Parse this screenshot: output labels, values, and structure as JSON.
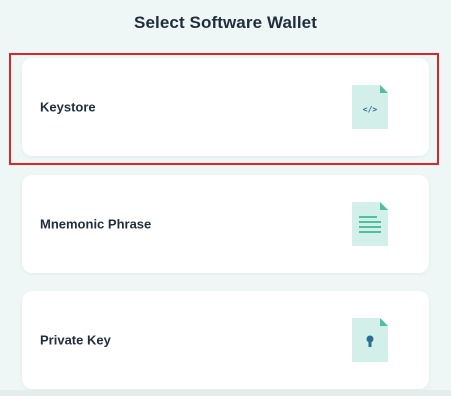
{
  "header": {
    "title": "Select Software Wallet"
  },
  "options": [
    {
      "label": "Keystore",
      "icon": "code-file-icon",
      "selected": true
    },
    {
      "label": "Mnemonic Phrase",
      "icon": "text-file-icon",
      "selected": false
    },
    {
      "label": "Private Key",
      "icon": "key-file-icon",
      "selected": false
    }
  ],
  "colors": {
    "background": "#eef6f6",
    "card": "#ffffff",
    "text": "#1f2d3d",
    "icon_fill": "#d3efe9",
    "icon_accent": "#4fbf9f",
    "icon_dark": "#2a6f8f",
    "highlight": "#d9262a"
  }
}
